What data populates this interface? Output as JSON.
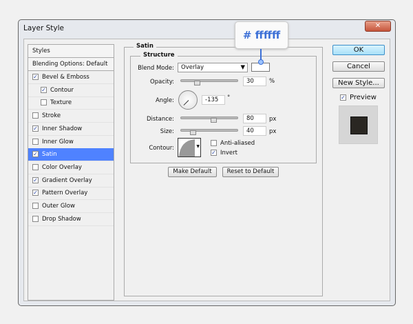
{
  "window": {
    "title": "Layer Style",
    "close_icon": "close-icon"
  },
  "styles_list": {
    "header": "Styles",
    "blending": "Blending Options: Default",
    "items": [
      {
        "label": "Bevel & Emboss",
        "checked": true,
        "indent": false
      },
      {
        "label": "Contour",
        "checked": true,
        "indent": true
      },
      {
        "label": "Texture",
        "checked": false,
        "indent": true
      },
      {
        "label": "Stroke",
        "checked": false,
        "indent": false
      },
      {
        "label": "Inner Shadow",
        "checked": true,
        "indent": false
      },
      {
        "label": "Inner Glow",
        "checked": false,
        "indent": false
      },
      {
        "label": "Satin",
        "checked": true,
        "indent": false,
        "selected": true
      },
      {
        "label": "Color Overlay",
        "checked": false,
        "indent": false
      },
      {
        "label": "Gradient Overlay",
        "checked": true,
        "indent": false
      },
      {
        "label": "Pattern Overlay",
        "checked": true,
        "indent": false
      },
      {
        "label": "Outer Glow",
        "checked": false,
        "indent": false
      },
      {
        "label": "Drop Shadow",
        "checked": false,
        "indent": false
      }
    ]
  },
  "satin": {
    "title": "Satin",
    "structure": "Structure",
    "blend_mode_label": "Blend Mode:",
    "blend_mode": "Overlay",
    "color": "#ffffff",
    "opacity_label": "Opacity:",
    "opacity": "30",
    "opacity_unit": "%",
    "angle_label": "Angle:",
    "angle": "-135",
    "angle_unit": "°",
    "distance_label": "Distance:",
    "distance": "80",
    "distance_unit": "px",
    "size_label": "Size:",
    "size": "40",
    "size_unit": "px",
    "contour_label": "Contour:",
    "anti_aliased": "Anti-aliased",
    "anti_aliased_checked": false,
    "invert": "Invert",
    "invert_checked": true,
    "make_default": "Make Default",
    "reset_default": "Reset to Default"
  },
  "callout": "# ffffff",
  "buttons": {
    "ok": "OK",
    "cancel": "Cancel",
    "new_style": "New Style...",
    "preview": "Preview",
    "preview_checked": true
  },
  "colors": {
    "selected": "#4f82ff",
    "ok": "#bfe9fb",
    "callout_text": "#3b6fd6"
  }
}
